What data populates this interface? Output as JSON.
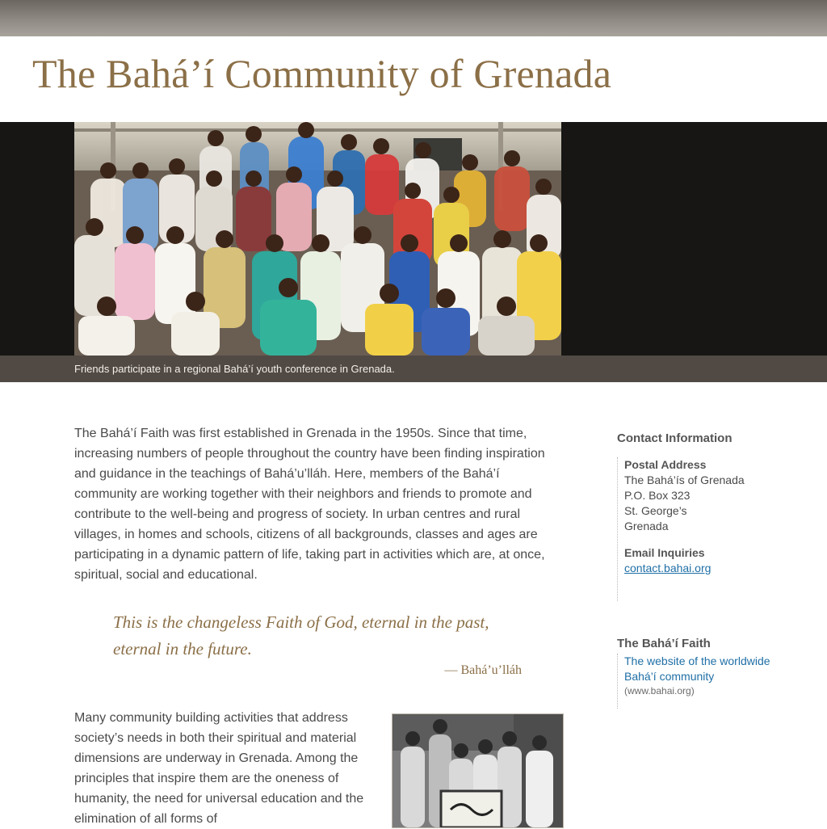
{
  "header": {
    "title": "The Bahá’í Community of Grenada"
  },
  "hero": {
    "caption": "Friends participate in a regional Bahá’í youth conference in Grenada."
  },
  "main": {
    "intro": "The Bahá’í Faith was first established in Grenada in the 1950s. Since that time, increasing numbers of people throughout the country have been finding inspiration and guidance in the teachings of Bahá’u’lláh. Here, members of the Bahá’í community are working together with their neighbors and friends to promote and contribute to the well-being and progress of society. In urban centres and rural villages, in homes and schools, citizens of all backgrounds, classes and ages are participating in a dynamic pattern of life, taking part in activities which are, at once, spiritual, social and educational.",
    "quote": "This is the changeless Faith of God, eternal in the past, eternal in the future.",
    "quote_attribution": "— Bahá’u’lláh",
    "paragraph2": "Many community building activities that address society’s needs in both their spiritual and material dimensions are underway in Grenada. Among the principles that inspire them are the oneness of humanity, the need for universal education and the elimination of all forms of"
  },
  "sidebar": {
    "contact": {
      "heading": "Contact Information",
      "postal_label": "Postal Address",
      "address_lines": [
        "The Bahá’ís of Grenada",
        "P.O. Box 323",
        "St. George’s",
        "Grenada"
      ],
      "email_label": "Email Inquiries",
      "email_link": "contact.bahai.org"
    },
    "faith": {
      "heading": "The Bahá’í Faith",
      "link_line1": "The website of the worldwide",
      "link_line2": "Bahá’í community",
      "url_note": "(www.bahai.org)"
    }
  }
}
